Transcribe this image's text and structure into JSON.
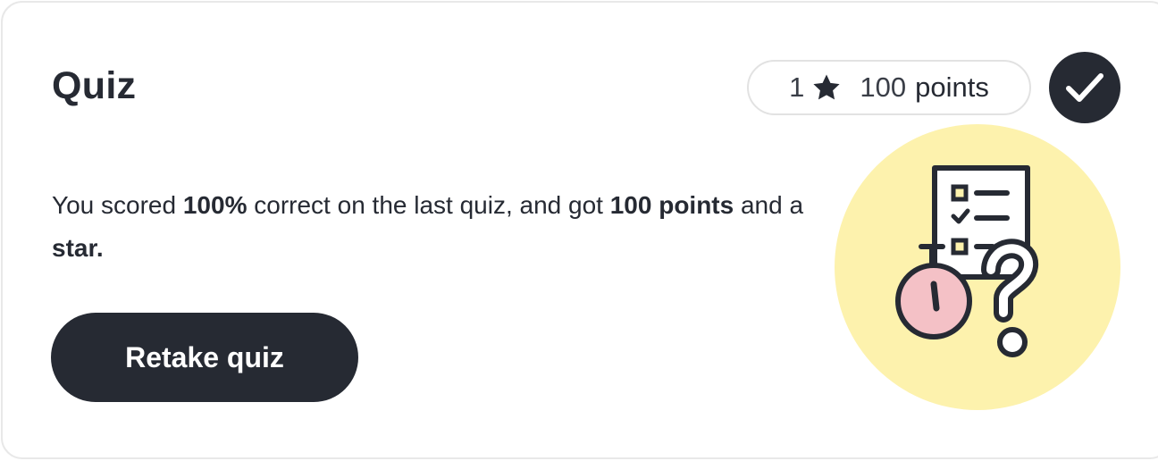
{
  "quiz_card": {
    "title": "Quiz",
    "score_pill": {
      "star_count": "1",
      "star_icon": "star-icon",
      "points_value": "100",
      "points_unit": "points"
    },
    "completed_icon": "checkmark-icon",
    "description": {
      "part1": "You scored ",
      "score_percent": "100%",
      "part2": " correct on the last quiz, and got ",
      "points_text": "100 points",
      "part3": " and a ",
      "star_text": "star."
    },
    "retake_button_label": "Retake quiz",
    "illustration_icon": "quiz-checklist-stopwatch-question-illustration"
  },
  "colors": {
    "dark": "#262a33",
    "illustration_bg": "#fdf2ad",
    "stopwatch_face": "#f4c1c6",
    "border": "#e8e8e8"
  }
}
